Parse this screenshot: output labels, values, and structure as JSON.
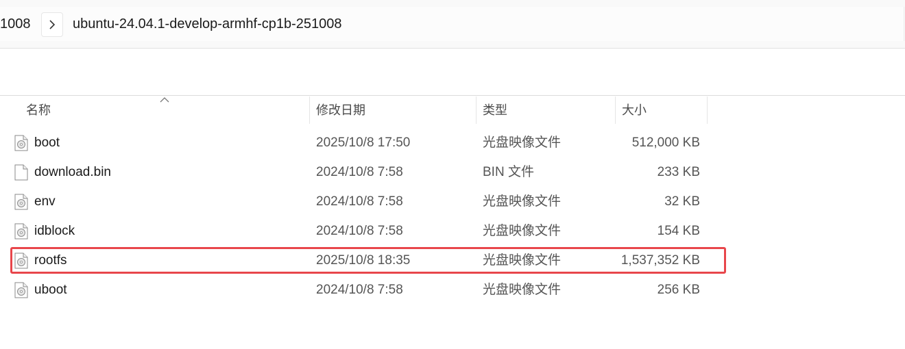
{
  "address_bar": {
    "parent_crumb": "1008",
    "separator_icon": "chevron-right-icon",
    "current_crumb": "ubuntu-24.04.1-develop-armhf-cp1b-251008"
  },
  "columns": {
    "name": "名称",
    "modified": "修改日期",
    "type": "类型",
    "size": "大小",
    "sort_indicator_icon": "sort-up-icon"
  },
  "files": [
    {
      "name": "boot",
      "modified": "2025/10/8 17:50",
      "type": "光盘映像文件",
      "size": "512,000 KB",
      "icon": "disc-image-file-icon"
    },
    {
      "name": "download.bin",
      "modified": "2024/10/8 7:58",
      "type": "BIN 文件",
      "size": "233 KB",
      "icon": "blank-file-icon"
    },
    {
      "name": "env",
      "modified": "2024/10/8 7:58",
      "type": "光盘映像文件",
      "size": "32 KB",
      "icon": "disc-image-file-icon"
    },
    {
      "name": "idblock",
      "modified": "2024/10/8 7:58",
      "type": "光盘映像文件",
      "size": "154 KB",
      "icon": "disc-image-file-icon"
    },
    {
      "name": "rootfs",
      "modified": "2025/10/8 18:35",
      "type": "光盘映像文件",
      "size": "1,537,352 KB",
      "icon": "disc-image-file-icon"
    },
    {
      "name": "uboot",
      "modified": "2024/10/8 7:58",
      "type": "光盘映像文件",
      "size": "256 KB",
      "icon": "disc-image-file-icon"
    }
  ],
  "highlight": {
    "target_file": "rootfs",
    "color": "#e8464b"
  }
}
